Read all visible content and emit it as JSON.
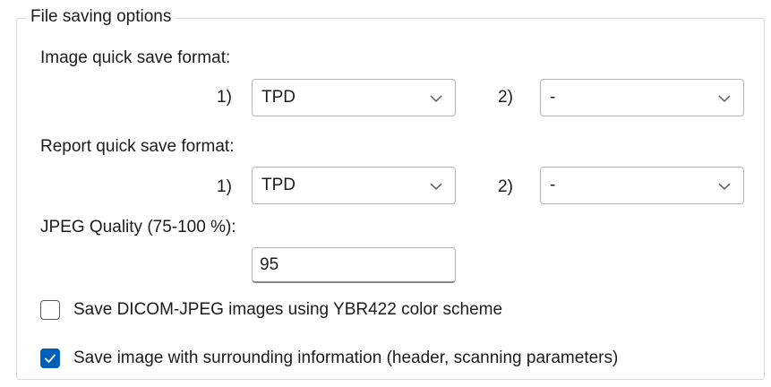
{
  "group": {
    "title": "File saving options"
  },
  "image_quick_save": {
    "label": "Image quick save format:",
    "slot1_label": "1)",
    "slot1_value": "TPD",
    "slot2_label": "2)",
    "slot2_value": "-"
  },
  "report_quick_save": {
    "label": "Report quick save format:",
    "slot1_label": "1)",
    "slot1_value": "TPD",
    "slot2_label": "2)",
    "slot2_value": "-"
  },
  "jpeg_quality": {
    "label": "JPEG Quality (75-100 %):",
    "value": "95"
  },
  "options": {
    "ybr422_label": "Save DICOM-JPEG images using YBR422 color scheme",
    "ybr422_checked": false,
    "surrounding_info_label": "Save image with surrounding information (header, scanning parameters)",
    "surrounding_info_checked": true
  },
  "colors": {
    "accent": "#005fb8",
    "border": "#b5b5b5",
    "group_border": "#d9d9d9"
  },
  "icons": {
    "dropdown": "chevron-down-icon",
    "check": "check-icon"
  }
}
